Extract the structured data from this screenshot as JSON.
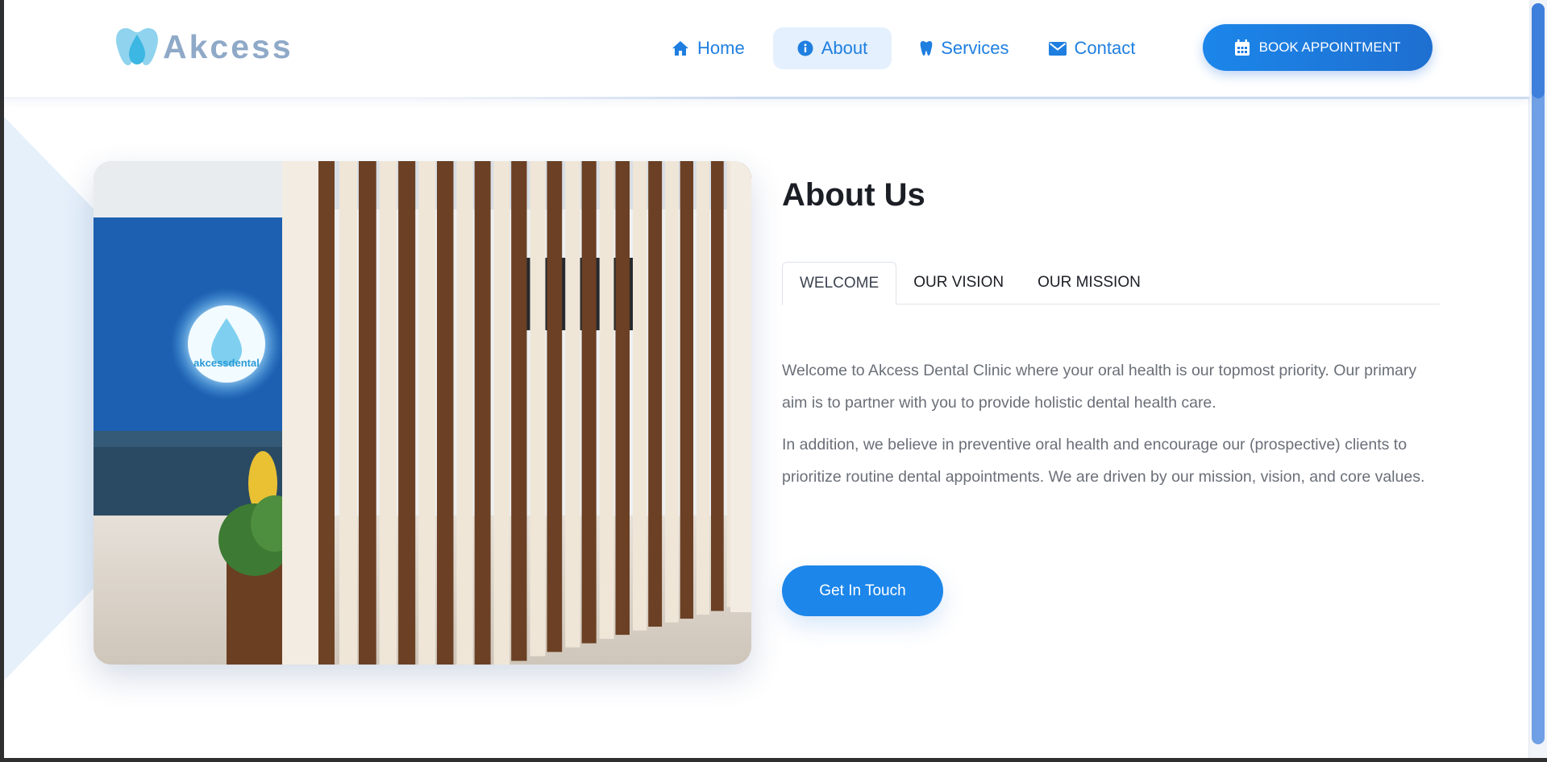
{
  "brand": {
    "name": "Akcess"
  },
  "nav": {
    "items": [
      {
        "label": "Home",
        "icon": "home-icon"
      },
      {
        "label": "About",
        "icon": "info-icon",
        "active": true
      },
      {
        "label": "Services",
        "icon": "tooth-icon"
      },
      {
        "label": "Contact",
        "icon": "envelope-icon"
      }
    ],
    "cta_label": "BOOK APPOINTMENT",
    "cta_icon": "calendar-icon"
  },
  "about": {
    "title": "About Us",
    "tabs": [
      {
        "label": "WELCOME",
        "active": true
      },
      {
        "label": "OUR VISION"
      },
      {
        "label": "OUR MISSION"
      }
    ],
    "paragraphs": [
      "Welcome to Akcess Dental Clinic where your oral health is our topmost priority. Our primary aim is to partner with you to provide holistic dental health care.",
      "In addition, we believe in preventive oral health and encourage our (prospective) clients to prioritize routine dental appointments. We are driven by our mission, vision, and core values."
    ],
    "button_label": "Get In Touch",
    "photo_sign_text": "akcessdental"
  },
  "colors": {
    "accent": "#1c86ea",
    "nav_text": "#1f7fe0",
    "nav_active_bg": "#e4f0fd",
    "logo_text": "#8fa9c8",
    "wall_blue": "#1d5fb0"
  }
}
